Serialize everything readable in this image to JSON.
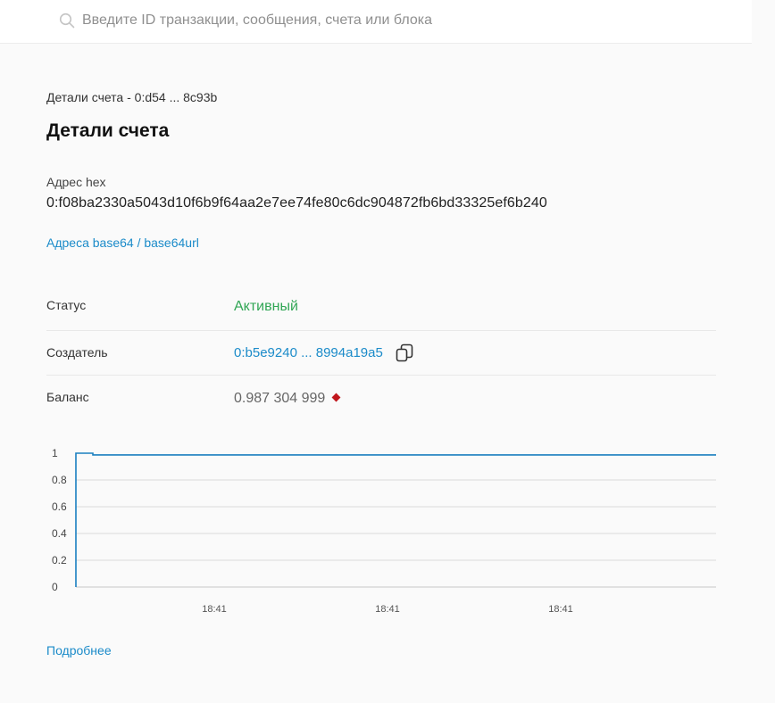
{
  "search": {
    "placeholder": "Введите ID транзакции, сообщения, счета или блока",
    "icon": "search-icon"
  },
  "breadcrumb": "Детали счета - 0:d54 ... 8c93b",
  "page_title": "Детали счета",
  "address": {
    "hex_label": "Адрес hex",
    "hex_value": "0:f08ba2330a5043d10f6b9f64aa2e7ee74fe80c6dc904872fb6bd33325ef6b240",
    "base64_link": "Адреса base64 / base64url"
  },
  "details": {
    "status_label": "Статус",
    "status_value": "Активный",
    "creator_label": "Создатель",
    "creator_value": "0:b5e9240 ... 8994a19a5",
    "balance_label": "Баланс",
    "balance_value": "0.987 304 999"
  },
  "colors": {
    "status_active": "#31a655",
    "link": "#1b8bc9",
    "chart_line": "#1a7fc0",
    "balance_diamond": "#c0161c"
  },
  "chart_data": {
    "type": "line",
    "y_ticks": [
      "1",
      "0.8",
      "0.6",
      "0.4",
      "0.2",
      "0"
    ],
    "x_tick_labels": [
      "18:41",
      "18:41",
      "18:41"
    ],
    "ylim": [
      0,
      1
    ],
    "grid": true,
    "series": [
      {
        "values": [
          0,
          1,
          1,
          0.987,
          0.987,
          0.987,
          0.987
        ]
      }
    ]
  },
  "more_link": "Подробнее"
}
